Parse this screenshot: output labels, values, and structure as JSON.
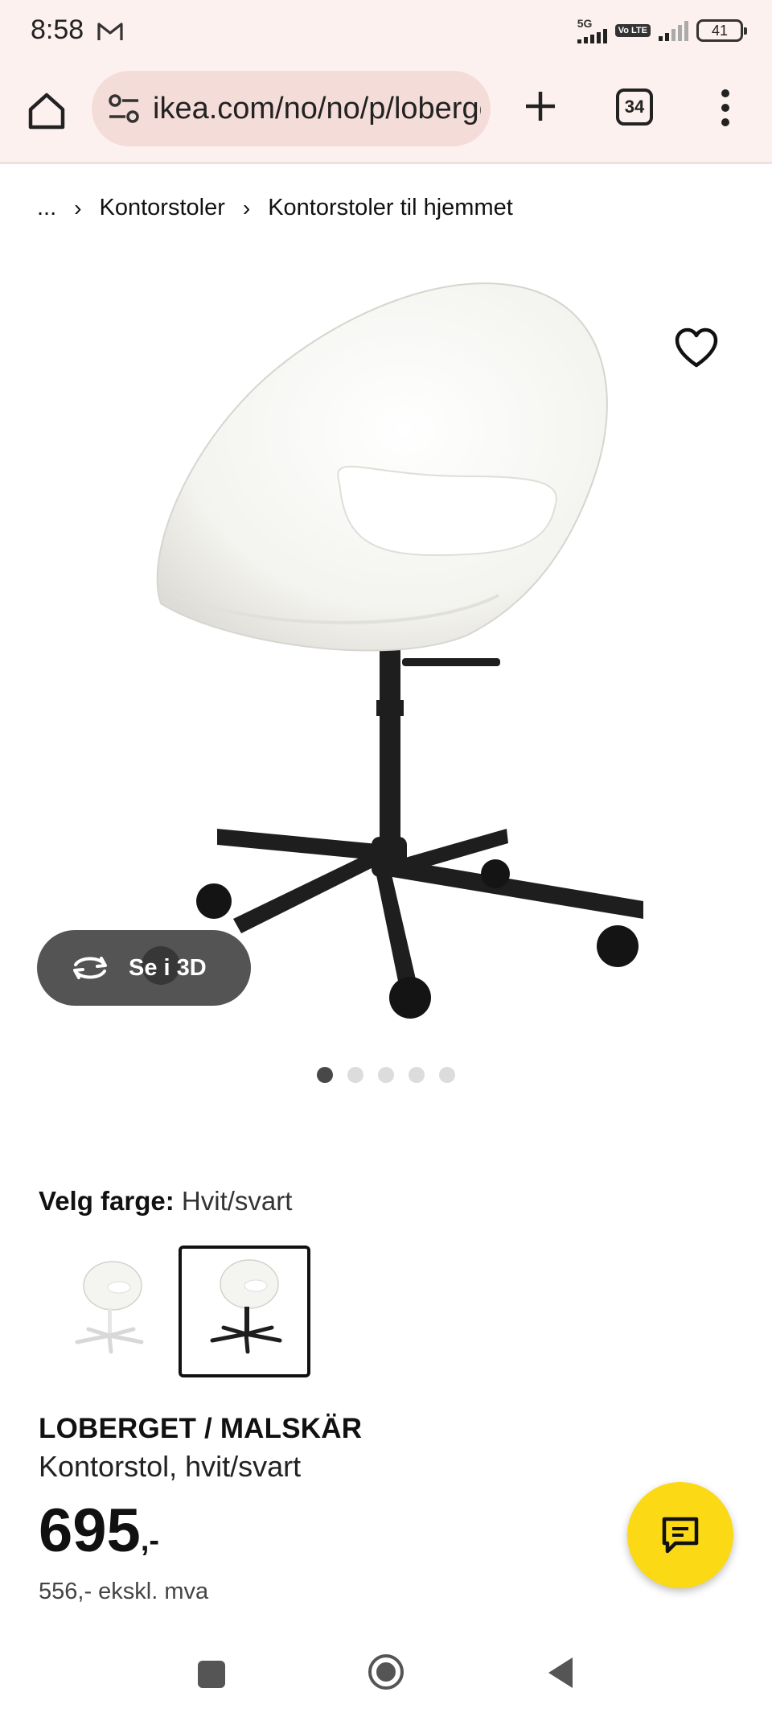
{
  "status_bar": {
    "time": "8:58",
    "network_label": "5G",
    "volte_label": "Vo LTE",
    "battery": "41"
  },
  "browser": {
    "url": "ikea.com/no/no/p/loberget-malskar-kontorstol",
    "tab_count": "34"
  },
  "breadcrumb": {
    "items": [
      "...",
      "Kontorstoler",
      "Kontorstoler til hjemmet"
    ]
  },
  "gallery": {
    "view_3d_label": "Se i 3D",
    "dots": 5,
    "active_dot": 0
  },
  "color": {
    "heading": "Velg farge:",
    "value": "Hvit/svart",
    "options": [
      "white-base",
      "black-base"
    ],
    "selected": 1
  },
  "product": {
    "name": "LOBERGET / MALSKÄR",
    "description": "Kontorstol, hvit/svart",
    "price_main": "695",
    "price_suffix": ",-",
    "price_ex_vat": "556,- ekskl. mva"
  },
  "colors": {
    "accent": "#fbd914",
    "toolbar_bg": "#fdf1ef",
    "url_pill_bg": "#f4dcd8"
  }
}
